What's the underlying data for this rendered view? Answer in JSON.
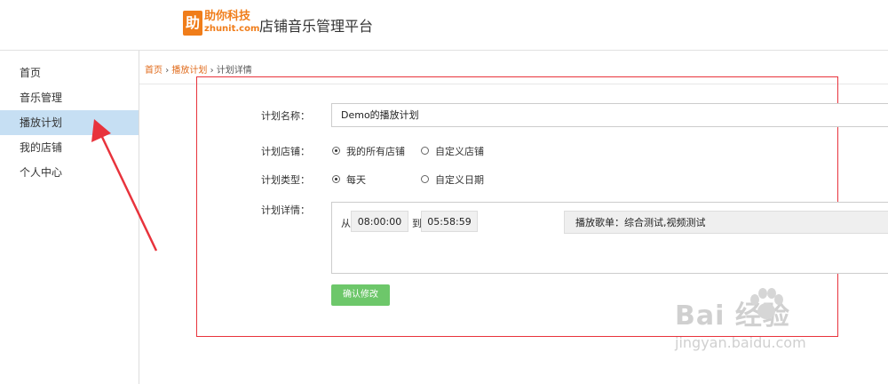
{
  "header": {
    "logo_char": "助",
    "logo_name": "助你科技",
    "logo_url": "zhunit.com",
    "platform_title": "店铺音乐管理平台"
  },
  "sidebar": {
    "items": [
      {
        "label": "首页"
      },
      {
        "label": "音乐管理"
      },
      {
        "label": "播放计划"
      },
      {
        "label": "我的店铺"
      },
      {
        "label": "个人中心"
      }
    ],
    "active_index": 2
  },
  "breadcrumb": {
    "home": "首页",
    "sep1": "›",
    "plan": "播放计划",
    "sep2": "›",
    "current": "计划详情"
  },
  "form": {
    "name_label": "计划名称：",
    "name_value": "Demo的播放计划",
    "store_label": "计划店铺：",
    "store_options": [
      "我的所有店铺",
      "自定义店铺"
    ],
    "store_selected": 0,
    "type_label": "计划类型：",
    "type_options": [
      "每天",
      "自定义日期"
    ],
    "type_selected": 0,
    "detail_label": "计划详情：",
    "detail": {
      "from": "从",
      "start_time": "08:00:00",
      "to": "到",
      "end_time": "05:58:59",
      "playlist": "播放歌单：综合测试,视频测试"
    },
    "confirm_label": "确认修改"
  },
  "colors": {
    "brand_orange": "#f07d1a",
    "active_nav": "#c6dff3",
    "confirm_green": "#6dc76a",
    "annotation_red": "#e8333c"
  },
  "watermark": {
    "main": "Bai 经验",
    "sub": "jingyan.baidu.com"
  }
}
